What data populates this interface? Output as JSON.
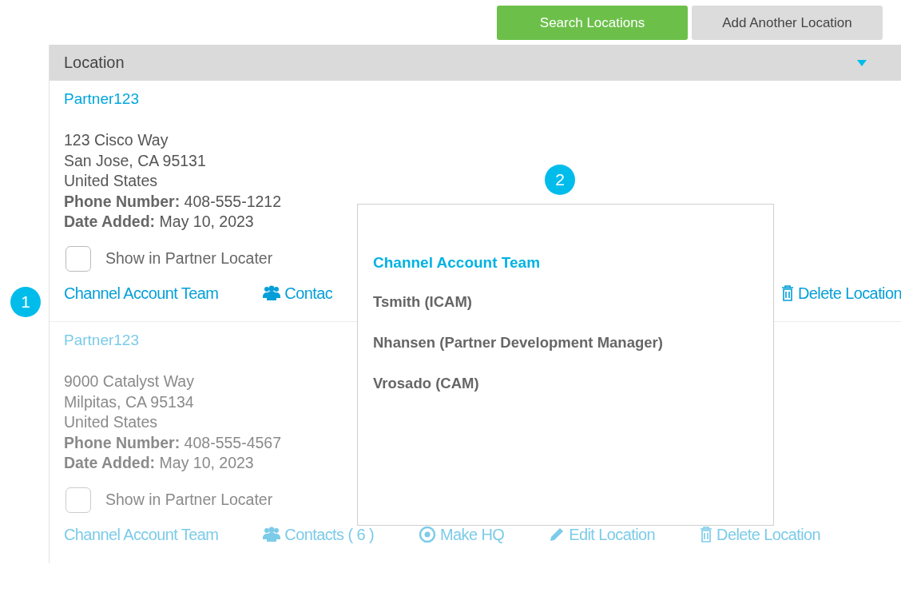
{
  "toolbar": {
    "buttons": [
      {
        "label": "Search Locations",
        "kind": "primary"
      },
      {
        "label": "Add Another Location",
        "kind": "secondary"
      }
    ]
  },
  "panel": {
    "header": "Location",
    "expanded": true
  },
  "locations": [
    {
      "name": "Partner123",
      "address": [
        "123 Cisco Way",
        "San Jose, CA 95131",
        "United States"
      ],
      "phone_label": "Phone Number:",
      "phone": "408-555-1212",
      "date_label": "Date Added:",
      "date": "May 10, 2023",
      "checkbox_label": "Show in Partner Locater",
      "checked": false,
      "disabled": false,
      "actions": [
        {
          "label": "Channel Account Team",
          "kind": "team"
        },
        {
          "label": "Contac",
          "kind": "contacts"
        },
        {
          "label": "Delete Location",
          "kind": "delete"
        }
      ]
    },
    {
      "name": "Partner123",
      "address": [
        "9000 Catalyst Way",
        "Milpitas, CA 95134",
        "United States"
      ],
      "phone_label": "Phone Number:",
      "phone": "408-555-4567",
      "date_label": "Date Added:",
      "date": "May 10, 2023",
      "checkbox_label": "Show in Partner Locater",
      "checked": false,
      "disabled": true,
      "actions": [
        {
          "label": "Channel Account Team",
          "kind": "team"
        },
        {
          "label": "Contacts ( 6 )",
          "kind": "contacts"
        },
        {
          "label": "Make HQ",
          "kind": "hq"
        },
        {
          "label": "Edit Location",
          "kind": "edit"
        },
        {
          "label": "Delete Location",
          "kind": "delete"
        }
      ]
    }
  ],
  "popup": {
    "title": "Channel Account Team",
    "members": [
      "Tsmith (ICAM)",
      "Nhansen (Partner Development Manager)",
      "Vrosado  (CAM)"
    ]
  },
  "callouts": [
    {
      "label": "1",
      "kind": "left"
    },
    {
      "label": "2",
      "kind": "popup"
    }
  ]
}
